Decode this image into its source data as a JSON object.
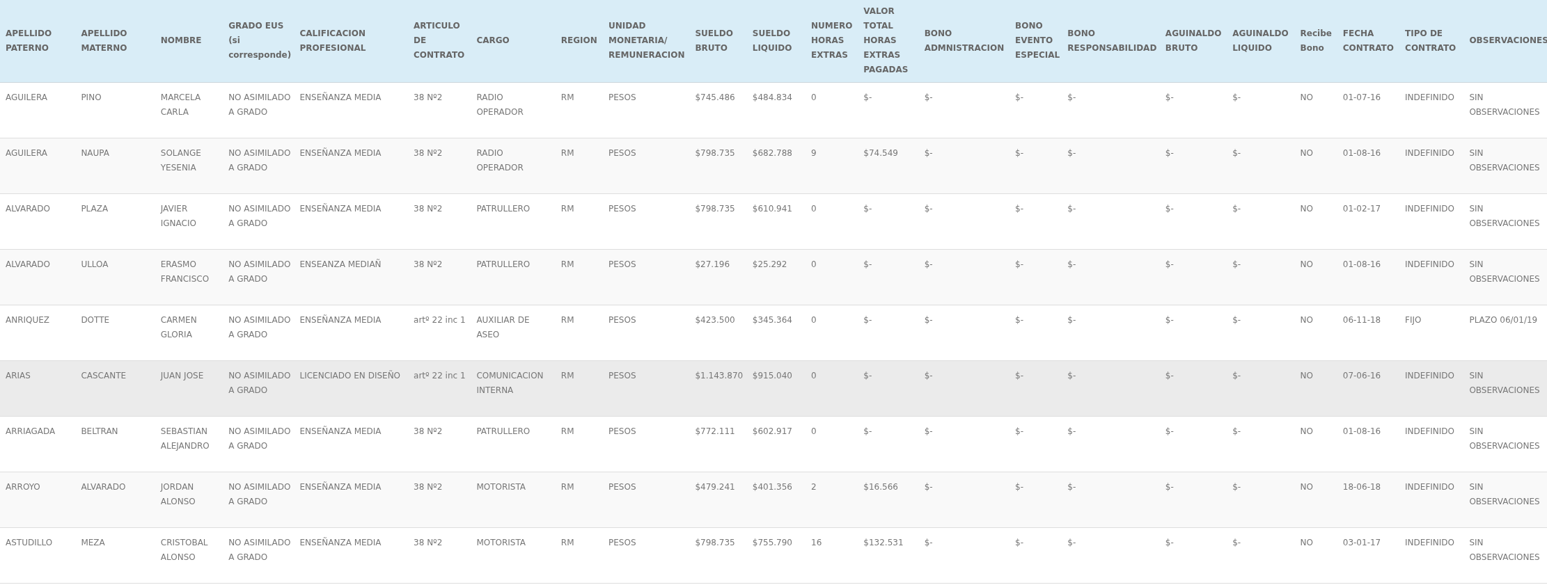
{
  "table": {
    "columns": [
      "APELLIDO PATERNO",
      "APELLIDO MATERNO",
      "NOMBRE",
      "GRADO EUS (si corresponde)",
      "CALIFICACION PROFESIONAL",
      "ARTICULO DE CONTRATO",
      "CARGO",
      "REGION",
      "UNIDAD MONETARIA/ REMUNERACION",
      "SUELDO BRUTO",
      "SUELDO LIQUIDO",
      "NUMERO HORAS EXTRAS",
      "VALOR TOTAL HORAS EXTRAS PAGADAS",
      "BONO ADMNISTRACION",
      "BONO EVENTO ESPECIAL",
      "BONO RESPONSABILIDAD",
      "AGUINALDO BRUTO",
      "AGUINALDO LIQUIDO",
      "Recibe Bono",
      "FECHA CONTRATO",
      "TIPO DE CONTRATO",
      "OBSERVACIONES"
    ],
    "rows": [
      {
        "selected": false,
        "cells": [
          "AGUILERA",
          "PINO",
          "MARCELA CARLA",
          "NO ASIMILADO A GRADO",
          "ENSEÑANZA MEDIA",
          "38 Nº2",
          "RADIO OPERADOR",
          "RM",
          "PESOS",
          "$745.486",
          "$484.834",
          "0",
          "$-",
          "$-",
          "$-",
          "$-",
          "$-",
          "$-",
          "NO",
          "01-07-16",
          "INDEFINIDO",
          "SIN OBSERVACIONES"
        ]
      },
      {
        "selected": false,
        "cells": [
          "AGUILERA",
          "NAUPA",
          "SOLANGE YESENIA",
          "NO ASIMILADO A GRADO",
          "ENSEÑANZA MEDIA",
          "38 Nº2",
          "RADIO OPERADOR",
          "RM",
          "PESOS",
          "$798.735",
          "$682.788",
          "9",
          "$74.549",
          "$-",
          "$-",
          "$-",
          "$-",
          "$-",
          "NO",
          "01-08-16",
          "INDEFINIDO",
          "SIN OBSERVACIONES"
        ]
      },
      {
        "selected": false,
        "cells": [
          "ALVARADO",
          "PLAZA",
          "JAVIER IGNACIO",
          "NO ASIMILADO A GRADO",
          "ENSEÑANZA MEDIA",
          "38 Nº2",
          "PATRULLERO",
          "RM",
          "PESOS",
          "$798.735",
          "$610.941",
          "0",
          "$-",
          "$-",
          "$-",
          "$-",
          "$-",
          "$-",
          "NO",
          "01-02-17",
          "INDEFINIDO",
          "SIN OBSERVACIONES"
        ]
      },
      {
        "selected": false,
        "cells": [
          "ALVARADO",
          "ULLOA",
          "ERASMO FRANCISCO",
          "NO ASIMILADO A GRADO",
          "ENSEANZA MEDIAÑ",
          "38 Nº2",
          "PATRULLERO",
          "RM",
          "PESOS",
          "$27.196",
          "$25.292",
          "0",
          "$-",
          "$-",
          "$-",
          "$-",
          "$-",
          "$-",
          "NO",
          "01-08-16",
          "INDEFINIDO",
          "SIN OBSERVACIONES"
        ]
      },
      {
        "selected": false,
        "cells": [
          "ANRIQUEZ",
          "DOTTE",
          "CARMEN GLORIA",
          "NO ASIMILADO A GRADO",
          "ENSEÑANZA MEDIA",
          "artº 22 inc 1",
          "AUXILIAR DE ASEO",
          "RM",
          "PESOS",
          "$423.500",
          "$345.364",
          "0",
          "$-",
          "$-",
          "$-",
          "$-",
          "$-",
          "$-",
          "NO",
          "06-11-18",
          "FIJO",
          "PLAZO 06/01/19"
        ]
      },
      {
        "selected": true,
        "cells": [
          "ARIAS",
          "CASCANTE",
          "JUAN JOSE",
          "NO ASIMILADO A GRADO",
          "LICENCIADO EN DISEÑO",
          "artº 22 inc 1",
          "COMUNICACION INTERNA",
          "RM",
          "PESOS",
          "$1.143.870",
          "$915.040",
          "0",
          "$-",
          "$-",
          "$-",
          "$-",
          "$-",
          "$-",
          "NO",
          "07-06-16",
          "INDEFINIDO",
          "SIN OBSERVACIONES"
        ]
      },
      {
        "selected": false,
        "cells": [
          "ARRIAGADA",
          "BELTRAN",
          "SEBASTIAN ALEJANDRO",
          "NO ASIMILADO A GRADO",
          "ENSEÑANZA MEDIA",
          "38 Nº2",
          "PATRULLERO",
          "RM",
          "PESOS",
          "$772.111",
          "$602.917",
          "0",
          "$-",
          "$-",
          "$-",
          "$-",
          "$-",
          "$-",
          "NO",
          "01-08-16",
          "INDEFINIDO",
          "SIN OBSERVACIONES"
        ]
      },
      {
        "selected": false,
        "cells": [
          "ARROYO",
          "ALVARADO",
          "JORDAN ALONSO",
          "NO ASIMILADO A GRADO",
          "ENSEÑANZA MEDIA",
          "38 Nº2",
          "MOTORISTA",
          "RM",
          "PESOS",
          "$479.241",
          "$401.356",
          "2",
          "$16.566",
          "$-",
          "$-",
          "$-",
          "$-",
          "$-",
          "NO",
          "18-06-18",
          "INDEFINIDO",
          "SIN OBSERVACIONES"
        ]
      },
      {
        "selected": false,
        "cells": [
          "ASTUDILLO",
          "MEZA",
          "CRISTOBAL ALONSO",
          "NO ASIMILADO A GRADO",
          "ENSEÑANZA MEDIA",
          "38 Nº2",
          "MOTORISTA",
          "RM",
          "PESOS",
          "$798.735",
          "$755.790",
          "16",
          "$132.531",
          "$-",
          "$-",
          "$-",
          "$-",
          "$-",
          "NO",
          "03-01-17",
          "INDEFINIDO",
          "SIN OBSERVACIONES"
        ]
      }
    ]
  }
}
